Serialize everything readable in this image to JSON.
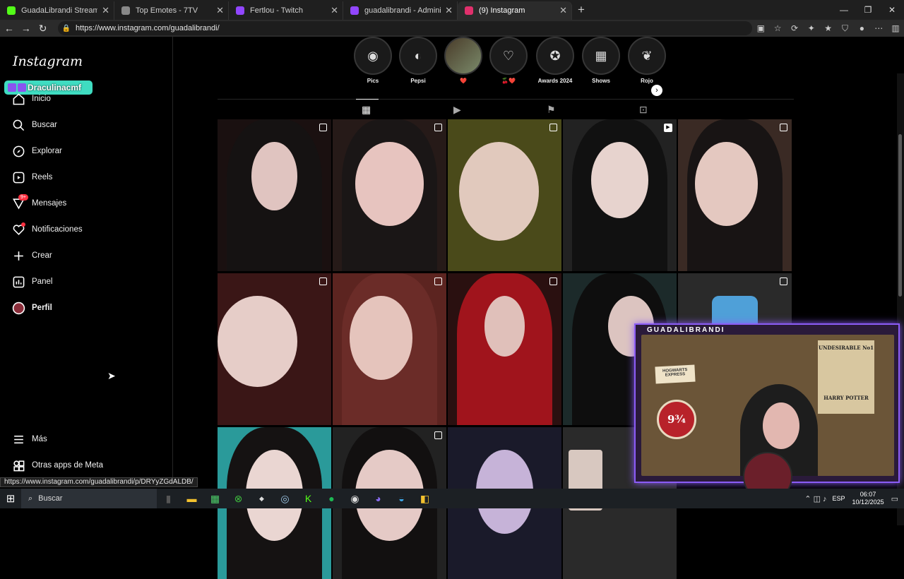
{
  "browser": {
    "tabs": [
      {
        "title": "GuadaLibrandi Stream - Watch Liv",
        "favicon_color": "#53fc18",
        "active": false
      },
      {
        "title": "Top Emotes - 7TV",
        "favicon_color": "#888888",
        "active": false
      },
      {
        "title": "Fertlou - Twitch",
        "favicon_color": "#9146ff",
        "active": false
      },
      {
        "title": "guadalibrandi - Administrador de",
        "favicon_color": "#9146ff",
        "active": false
      },
      {
        "title": "(9) Instagram",
        "favicon_color": "#e1306c",
        "active": true
      }
    ],
    "new_tab": "+",
    "url": "https://www.instagram.com/guadalibrandi/",
    "status_url": "https://www.instagram.com/guadalibrandi/p/DRYyZGdALDB/"
  },
  "instagram": {
    "logo": "Instagram",
    "overlay_user": "Draculinacmf",
    "nav": [
      {
        "label": "Inicio",
        "icon": "home-icon"
      },
      {
        "label": "Buscar",
        "icon": "search-icon"
      },
      {
        "label": "Explorar",
        "icon": "compass-icon"
      },
      {
        "label": "Reels",
        "icon": "reels-icon"
      },
      {
        "label": "Mensajes",
        "icon": "messenger-icon",
        "badge": "9+"
      },
      {
        "label": "Notificaciones",
        "icon": "heart-icon"
      },
      {
        "label": "Crear",
        "icon": "plus-icon"
      },
      {
        "label": "Panel",
        "icon": "dashboard-icon"
      },
      {
        "label": "Perfil",
        "icon": "avatar"
      }
    ],
    "bottom_nav": [
      {
        "label": "Más",
        "icon": "menu-icon"
      },
      {
        "label": "Otras apps de Meta",
        "icon": "meta-apps-icon"
      }
    ],
    "highlights": [
      {
        "label": "Pics"
      },
      {
        "label": "Pepsi"
      },
      {
        "label": "❤️"
      },
      {
        "label": "🍒❤️"
      },
      {
        "label": "Awards 2024"
      },
      {
        "label": "Shows"
      },
      {
        "label": "Rojo"
      }
    ],
    "profile_tabs": [
      "posts-grid",
      "reels",
      "saved",
      "tagged"
    ]
  },
  "stream_overlay": {
    "name": "GUADALIBRANDI",
    "poster_top": "UNDESIRABLE No1",
    "poster_bottom": "HARRY POTTER",
    "sign": "HOGWARTS EXPRESS",
    "platform": "9¾"
  },
  "taskbar": {
    "search_placeholder": "Buscar",
    "lang": "ESP",
    "time": "06:07",
    "date": "10/12/2025"
  }
}
